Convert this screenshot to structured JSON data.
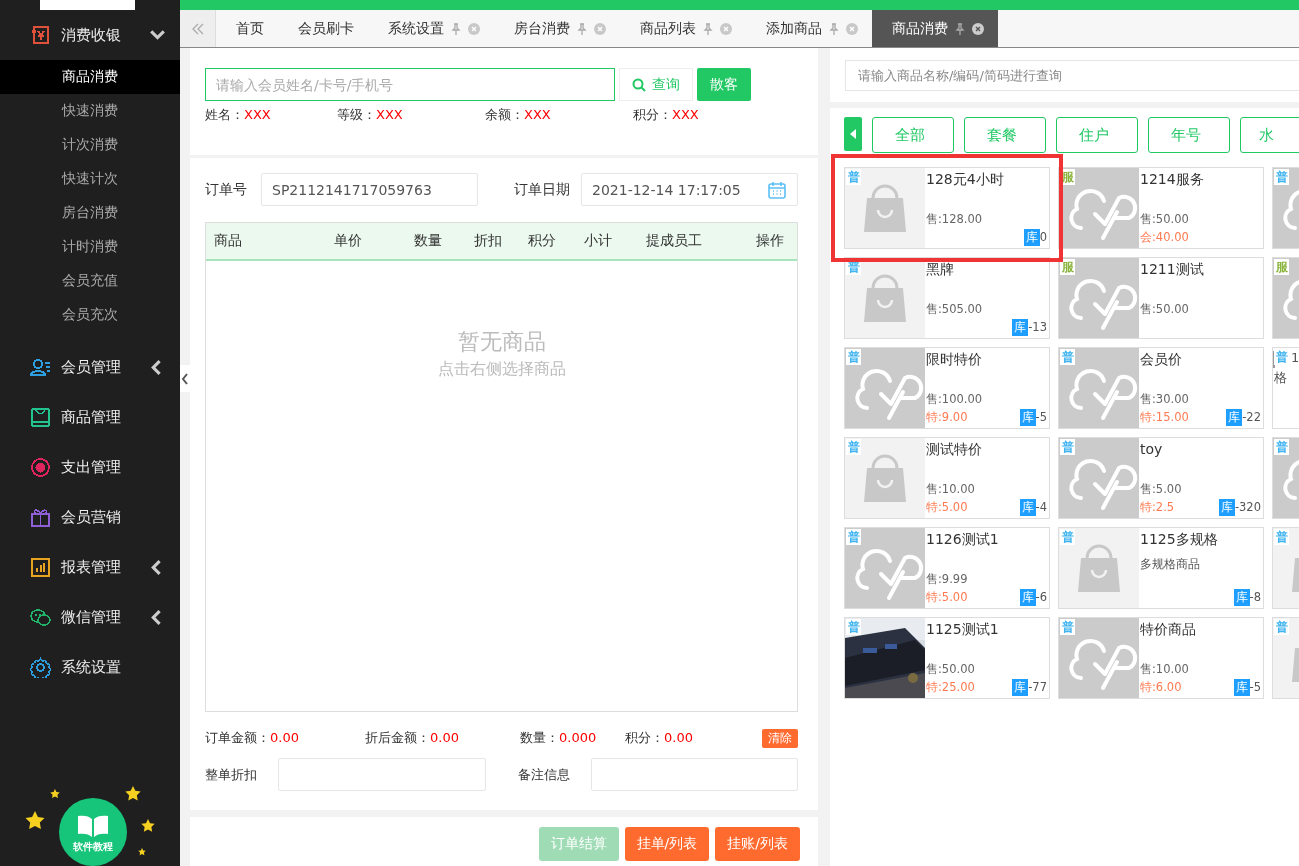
{
  "sidebar": {
    "sections": [
      {
        "label": "消费收银",
        "color": "#e0513c",
        "expanded": true,
        "children": [
          {
            "label": "商品消费",
            "selected": true
          },
          {
            "label": "快速消费",
            "selected": false
          },
          {
            "label": "计次消费",
            "selected": false
          },
          {
            "label": "快速计次",
            "selected": false
          },
          {
            "label": "房台消费",
            "selected": false
          },
          {
            "label": "计时消费",
            "selected": false
          },
          {
            "label": "会员充值",
            "selected": false
          },
          {
            "label": "会员充次",
            "selected": false
          }
        ]
      },
      {
        "label": "会员管理",
        "color": "#2d9fe0",
        "expanded": false
      },
      {
        "label": "商品管理",
        "color": "#22c38e"
      },
      {
        "label": "支出管理",
        "color": "#e0245e"
      },
      {
        "label": "会员营销",
        "color": "#8e5fd6"
      },
      {
        "label": "报表管理",
        "color": "#e8a320",
        "expanded": false
      },
      {
        "label": "微信管理",
        "color": "#1fb46a",
        "expanded": false
      },
      {
        "label": "系统设置",
        "color": "#2d9fe0"
      }
    ],
    "tutorial": "软件教程"
  },
  "tabs": [
    {
      "label": "首页",
      "closable": false,
      "selected": false
    },
    {
      "label": "会员刷卡",
      "closable": false,
      "selected": false
    },
    {
      "label": "系统设置",
      "closable": true,
      "selected": false
    },
    {
      "label": "房台消费",
      "closable": true,
      "selected": false
    },
    {
      "label": "商品列表",
      "closable": true,
      "selected": false
    },
    {
      "label": "添加商品",
      "closable": true,
      "selected": false
    },
    {
      "label": "商品消费",
      "closable": true,
      "selected": true
    }
  ],
  "member": {
    "placeholder": "请输入会员姓名/卡号/手机号",
    "search_button": "查询",
    "guest_button": "散客",
    "info": [
      {
        "label": "姓名：",
        "value": "XXX"
      },
      {
        "label": "等级：",
        "value": "XXX"
      },
      {
        "label": "余额：",
        "value": "XXX"
      },
      {
        "label": "积分：",
        "value": "XXX"
      }
    ]
  },
  "order": {
    "number_label": "订单号",
    "number": "SP2112141717059763",
    "date_label": "订单日期",
    "date": "2021-12-14 17:17:05",
    "columns": [
      "商品",
      "单价",
      "数量",
      "折扣",
      "积分",
      "小计",
      "提成员工",
      "操作"
    ],
    "empty_title": "暂无商品",
    "empty_hint": "点击右侧选择商品",
    "summary": [
      {
        "label": "订单金额：",
        "value": "0.00"
      },
      {
        "label": "折后金额：",
        "value": "0.00"
      },
      {
        "label": "数量：",
        "value": "0.000"
      },
      {
        "label": "积分：",
        "value": "0.00"
      }
    ],
    "clear_button": "清除",
    "discount_label": "整单折扣",
    "remark_label": "备注信息"
  },
  "actions": [
    {
      "label": "订单结算",
      "disabled": true
    },
    {
      "label": "挂单/列表",
      "disabled": false
    },
    {
      "label": "挂账/列表",
      "disabled": false
    }
  ],
  "goods": {
    "placeholder": "请输入商品名称/编码/简码进行查询",
    "categories": [
      "全部",
      "套餐",
      "住户",
      "年号",
      "水"
    ],
    "products": [
      {
        "kind": "bag",
        "tag": "普",
        "color": "#3fb4f0",
        "name": "128元4小时",
        "sale": "售:128.00",
        "stock_label": "库",
        "stock": "0",
        "highlighted": true
      },
      {
        "kind": "cloud",
        "tag": "服",
        "color": "#8ab43c",
        "name": "1214服务",
        "sale": "售:50.00",
        "special": "会:40.00",
        "highlighted": false
      },
      {
        "kind": "cloud",
        "tag": "普",
        "color": "#3fb4f0"
      },
      {
        "kind": "bag",
        "tag": "普",
        "color": "#3fb4f0",
        "name": "黑牌",
        "sale": "售:505.00",
        "stock_label": "库",
        "stock": "-13",
        "highlighted": false
      },
      {
        "kind": "cloud",
        "tag": "服",
        "color": "#8ab43c",
        "name": "1211测试",
        "sale": "售:50.00",
        "highlighted": false
      },
      {
        "kind": "cloud",
        "tag": "服",
        "color": "#8ab43c"
      },
      {
        "kind": "cloud",
        "tag": "普",
        "color": "#3fb4f0",
        "name": "限时特价",
        "sale": "售:100.00",
        "special": "特:9.00",
        "stock_label": "库",
        "stock": "-5",
        "highlighted": false
      },
      {
        "kind": "cloud",
        "tag": "普",
        "color": "#3fb4f0",
        "name": "会员价",
        "sale": "售:30.00",
        "special": "特:15.00",
        "stock_label": "库",
        "stock": "-22",
        "highlighted": false
      },
      {
        "kind": "broken",
        "tag": "普",
        "color": "#3fb4f0",
        "lines": [
          "1",
          "格"
        ]
      },
      {
        "kind": "bag",
        "tag": "普",
        "color": "#3fb4f0",
        "name": "测试特价",
        "sale": "售:10.00",
        "special": "特:5.00",
        "stock_label": "库",
        "stock": "-4",
        "highlighted": false
      },
      {
        "kind": "cloud",
        "tag": "普",
        "color": "#3fb4f0",
        "name": "toy",
        "sale": "售:5.00",
        "special": "特:2.5",
        "stock_label": "库",
        "stock": "-320",
        "highlighted": false
      },
      {
        "kind": "cloud",
        "tag": "普",
        "color": "#3fb4f0"
      },
      {
        "kind": "cloud",
        "tag": "普",
        "color": "#3fb4f0",
        "name": "1126测试1",
        "sale": "售:9.99",
        "special": "特:5.00",
        "stock_label": "库",
        "stock": "-6",
        "highlighted": false
      },
      {
        "kind": "bag",
        "tag": "普",
        "color": "#3fb4f0",
        "name": "1125多规格",
        "note": "多规格商品",
        "stock_label": "库",
        "stock": "-8",
        "highlighted": false
      },
      {
        "kind": "bag",
        "tag": "普",
        "color": "#3fb4f0"
      },
      {
        "tag": "普",
        "color": "#3fb4f0",
        "name": "1125测试1",
        "sale": "售:50.00",
        "special": "特:25.00",
        "stock_label": "库",
        "stock": "-77",
        "highlighted": false
      },
      {
        "kind": "cloud",
        "tag": "普",
        "color": "#3fb4f0",
        "name": "特价商品",
        "sale": "售:10.00",
        "special": "特:6.00",
        "stock_label": "库",
        "stock": "-5",
        "highlighted": false
      },
      {
        "kind": "bag",
        "tag": "普",
        "color": "#3fb4f0"
      }
    ]
  }
}
